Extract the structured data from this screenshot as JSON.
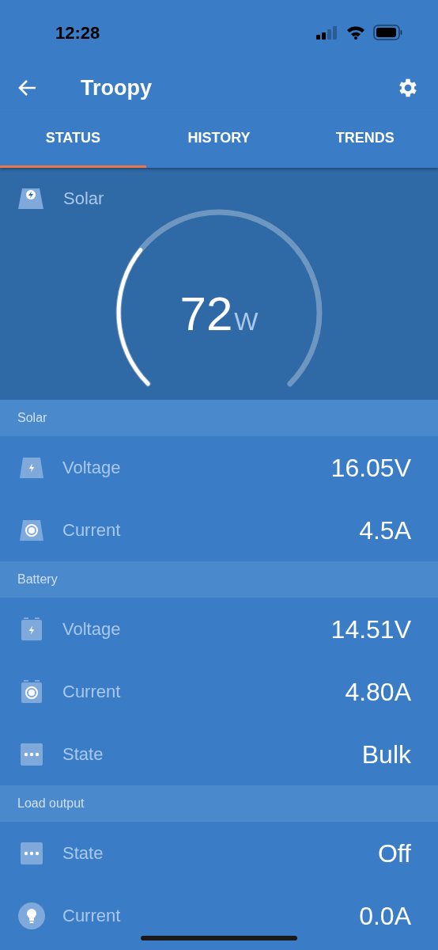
{
  "status_bar": {
    "time": "12:28"
  },
  "header": {
    "title": "Troopy"
  },
  "tabs": [
    {
      "label": "STATUS",
      "selected": true
    },
    {
      "label": "HISTORY",
      "selected": false
    },
    {
      "label": "TRENDS",
      "selected": false
    }
  ],
  "gauge": {
    "label": "Solar",
    "value": "72",
    "unit": "W"
  },
  "sections": [
    {
      "title": "Solar",
      "rows": [
        {
          "kind": "panel_voltage",
          "label": "Voltage",
          "value": "16.05V"
        },
        {
          "kind": "panel_current",
          "label": "Current",
          "value": "4.5A"
        }
      ]
    },
    {
      "title": "Battery",
      "rows": [
        {
          "kind": "battery_voltage",
          "label": "Voltage",
          "value": "14.51V"
        },
        {
          "kind": "battery_current",
          "label": "Current",
          "value": "4.80A"
        },
        {
          "kind": "state",
          "label": "State",
          "value": "Bulk"
        }
      ]
    },
    {
      "title": "Load output",
      "rows": [
        {
          "kind": "state",
          "label": "State",
          "value": "Off"
        },
        {
          "kind": "bulb",
          "label": "Current",
          "value": "0.0A"
        }
      ]
    }
  ]
}
